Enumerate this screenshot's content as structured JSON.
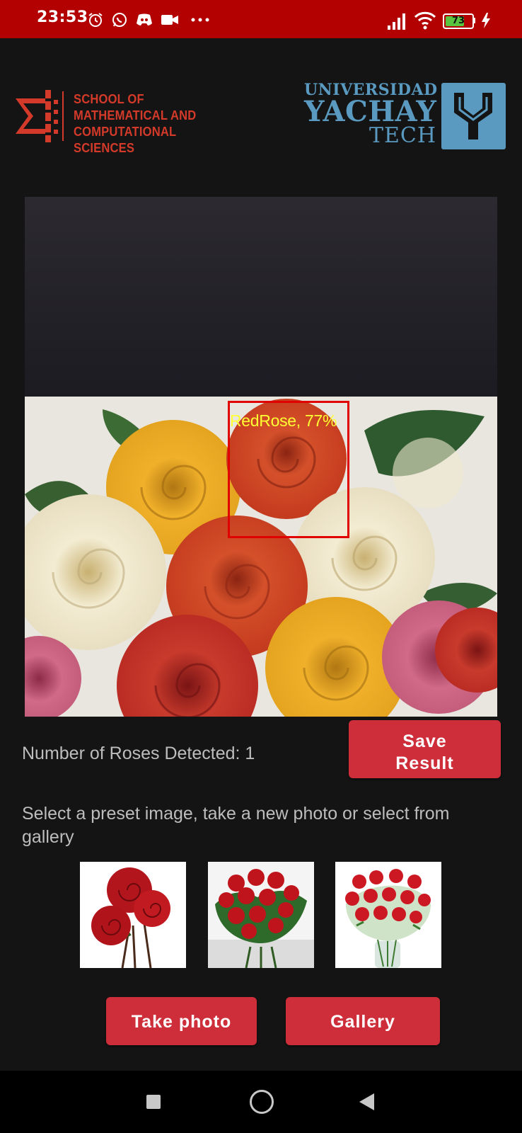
{
  "status_bar": {
    "time": "23:53",
    "icons": [
      "alarm-icon",
      "whatsapp-icon",
      "discord-icon",
      "video-icon",
      "more-icon"
    ],
    "right_icons": [
      "signal-icon",
      "wifi-icon",
      "battery-icon",
      "charging-icon"
    ],
    "battery_level": "73",
    "battery_fraction": 0.73
  },
  "logos": {
    "school_lines": [
      "SCHOOL OF",
      "MATHEMATICAL AND",
      "COMPUTATIONAL SCIENCES"
    ],
    "university_line1": "UNIVERSIDAD",
    "university_line2": "YACHAY",
    "university_line3": "TECH"
  },
  "detection": {
    "label": "RedRose, 77%",
    "box_color": "#e00000",
    "label_color": "#ffff33"
  },
  "result": {
    "count_text": "Number of Roses Detected: 1",
    "save_label_line1": "Save",
    "save_label_line2": "Result"
  },
  "instructions": "Select a preset image, take a new photo or select from gallery",
  "presets": [
    "preset-image-1",
    "preset-image-2",
    "preset-image-3"
  ],
  "actions": {
    "take_photo_label": "Take photo",
    "gallery_label": "Gallery"
  },
  "colors": {
    "status_bar": "#b30000",
    "accent_button": "#cd2e3a",
    "background": "#141414",
    "school_logo": "#d43a2a",
    "yachay_logo": "#5a9ac0"
  },
  "nav_bar": [
    "recents-icon",
    "home-icon",
    "back-icon"
  ]
}
